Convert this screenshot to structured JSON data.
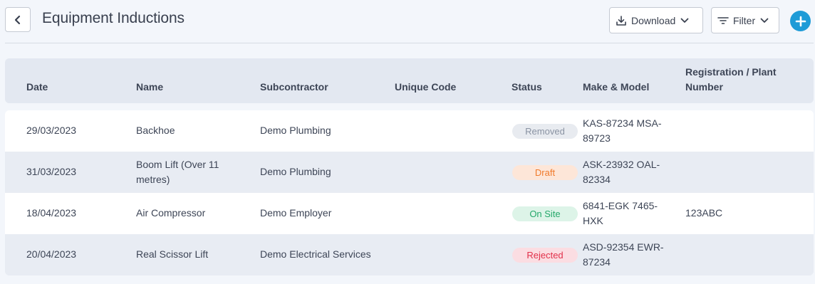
{
  "header": {
    "title": "Equipment Inductions",
    "download_label": "Download",
    "filter_label": "Filter"
  },
  "icons": {
    "back": "chevron-left-icon",
    "download": "download-icon",
    "filter": "filter-icon",
    "add": "plus-icon"
  },
  "colors": {
    "accent": "#1e9bd7",
    "status_removed": "#8a93a3",
    "status_draft": "#f07a2b",
    "status_onsite": "#25a86a",
    "status_rejected": "#e2304a"
  },
  "table": {
    "columns": {
      "date": "Date",
      "name": "Name",
      "subcontractor": "Subcontractor",
      "unique_code": "Unique Code",
      "status": "Status",
      "make_model": "Make & Model",
      "registration": "Registration / Plant Number"
    },
    "rows": [
      {
        "date": "29/03/2023",
        "name": "Backhoe",
        "subcontractor": "Demo Plumbing",
        "unique_code": "",
        "status": "Removed",
        "make_model": "KAS-87234 MSA-89723",
        "registration": ""
      },
      {
        "date": "31/03/2023",
        "name": "Boom Lift (Over 11 metres)",
        "subcontractor": "Demo Plumbing",
        "unique_code": "",
        "status": "Draft",
        "make_model": "ASK-23932 OAL-82334",
        "registration": ""
      },
      {
        "date": "18/04/2023",
        "name": "Air Compressor",
        "subcontractor": "Demo Employer",
        "unique_code": "",
        "status": "On Site",
        "make_model": "6841-EGK 7465-HXK",
        "registration": "123ABC"
      },
      {
        "date": "20/04/2023",
        "name": "Real Scissor Lift",
        "subcontractor": "Demo Electrical Services",
        "unique_code": "",
        "status": "Rejected",
        "make_model": "ASD-92354 EWR-87234",
        "registration": ""
      }
    ]
  }
}
